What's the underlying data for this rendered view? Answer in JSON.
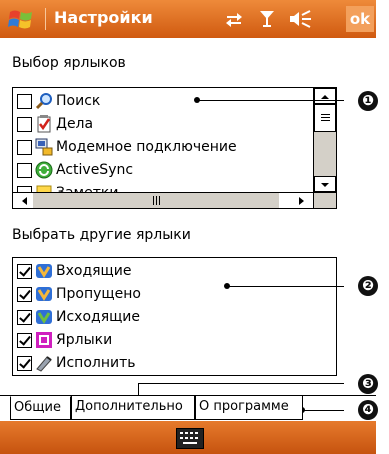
{
  "header": {
    "title": "Настройки",
    "ok_label": "ok",
    "brand_color": "#d05a10"
  },
  "section1": {
    "label": "Выбор ярлыков",
    "items": [
      {
        "label": "Поиск",
        "icon": "search-icon",
        "checked": false
      },
      {
        "label": "Дела",
        "icon": "tasks-icon",
        "checked": false
      },
      {
        "label": "Модемное подключение",
        "icon": "modem-icon",
        "checked": false
      },
      {
        "label": "ActiveSync",
        "icon": "activesync-icon",
        "checked": false
      },
      {
        "label": "Заметки",
        "icon": "notes-icon",
        "checked": false
      }
    ]
  },
  "section2": {
    "label": "Выбрать другие ярлыки",
    "items": [
      {
        "label": "Входящие",
        "icon": "inbox-icon",
        "checked": true
      },
      {
        "label": "Пропущено",
        "icon": "missed-icon",
        "checked": true
      },
      {
        "label": "Исходящие",
        "icon": "outgoing-icon",
        "checked": true
      },
      {
        "label": "Ярлыки",
        "icon": "shortcuts-icon",
        "checked": true
      },
      {
        "label": "Исполнить",
        "icon": "run-icon",
        "checked": true
      }
    ]
  },
  "tabs": [
    {
      "label": "Общие",
      "active": true
    },
    {
      "label": "Дополнительно",
      "active": false
    },
    {
      "label": "О программе",
      "active": false
    }
  ],
  "callouts": [
    "❶",
    "❷",
    "❸",
    "❹"
  ]
}
